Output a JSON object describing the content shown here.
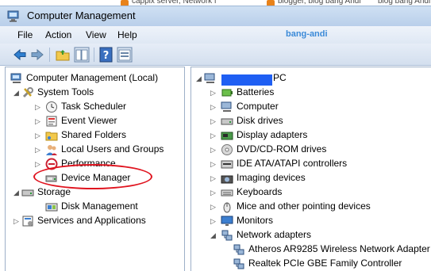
{
  "background_tabs": [
    {
      "label": "cappix server, Network f"
    },
    {
      "label": "blogger, blog bang Andi"
    },
    {
      "label": "blog bang Andi"
    }
  ],
  "window": {
    "title": "Computer Management"
  },
  "menu": {
    "items": [
      "File",
      "Action",
      "View",
      "Help"
    ],
    "user": "bang-andi"
  },
  "toolbar": {
    "buttons": [
      "back-arrow-icon",
      "forward-arrow-icon",
      "up-folder-icon",
      "show-hide-tree-icon",
      "help-icon",
      "properties-icon"
    ]
  },
  "left_tree": {
    "root": "Computer Management (Local)",
    "system_tools": "System Tools",
    "items": [
      {
        "label": "Task Scheduler",
        "icon": "clock-icon"
      },
      {
        "label": "Event Viewer",
        "icon": "event-viewer-icon"
      },
      {
        "label": "Shared Folders",
        "icon": "shared-folder-icon"
      },
      {
        "label": "Local Users and Groups",
        "icon": "users-icon"
      },
      {
        "label": "Performance",
        "icon": "performance-icon"
      },
      {
        "label": "Device Manager",
        "icon": "device-manager-icon"
      }
    ],
    "storage": "Storage",
    "disk_management": "Disk Management",
    "services": "Services and Applications"
  },
  "right_tree": {
    "computer_suffix": "PC",
    "categories": [
      {
        "label": "Batteries",
        "icon": "battery-icon"
      },
      {
        "label": "Computer",
        "icon": "computer-icon"
      },
      {
        "label": "Disk drives",
        "icon": "disk-drive-icon"
      },
      {
        "label": "Display adapters",
        "icon": "display-adapter-icon"
      },
      {
        "label": "DVD/CD-ROM drives",
        "icon": "dvd-icon"
      },
      {
        "label": "IDE ATA/ATAPI controllers",
        "icon": "ide-controller-icon"
      },
      {
        "label": "Imaging devices",
        "icon": "camera-icon"
      },
      {
        "label": "Keyboards",
        "icon": "keyboard-icon"
      },
      {
        "label": "Mice and other pointing devices",
        "icon": "mouse-icon"
      },
      {
        "label": "Monitors",
        "icon": "monitor-icon"
      },
      {
        "label": "Network adapters",
        "icon": "network-icon"
      }
    ],
    "network_children": [
      {
        "label": "Atheros AR9285 Wireless Network Adapter"
      },
      {
        "label": "Realtek PCIe GBE Family Controller"
      }
    ]
  },
  "colors": {
    "highlight_ellipse": "#e0141f",
    "redaction": "#1f5ff3",
    "user_label": "#3b8ad8"
  }
}
